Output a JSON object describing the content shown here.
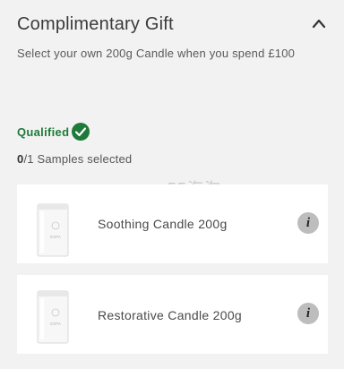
{
  "header": {
    "title": "Complimentary Gift",
    "collapse_icon": "chevron-up-icon"
  },
  "description": "Select your own 200g Candle when you spend £100",
  "status": {
    "qualified_label": "Qualified",
    "qualified_icon": "check-circle-icon",
    "qualified_color": "#1f7a3a"
  },
  "samples": {
    "selected": "0",
    "total": "/1",
    "label": "Samples selected"
  },
  "watermark": "55海淘",
  "items": [
    {
      "label": "Soothing Candle 200g",
      "info_icon": "info-icon"
    },
    {
      "label": "Restorative Candle 200g",
      "info_icon": "info-icon"
    }
  ],
  "candle_logo": "ESPA"
}
